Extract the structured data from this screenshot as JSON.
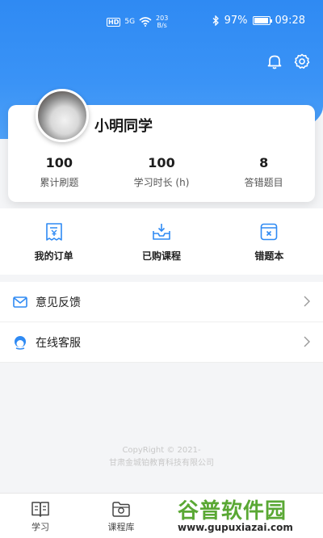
{
  "status_bar": {
    "network_badge": "HD",
    "signal": "5G",
    "speed_value": "203",
    "speed_unit": "B/s",
    "battery": "97%",
    "battery_level": 0.97,
    "time": "09:28"
  },
  "header": {
    "icons": [
      "bell-icon",
      "settings-icon"
    ]
  },
  "profile": {
    "username": "小明同学",
    "stats": [
      {
        "value": "100",
        "label": "累计刷题"
      },
      {
        "value": "100",
        "label": "学习时长 (h)"
      },
      {
        "value": "8",
        "label": "答错题目"
      }
    ]
  },
  "actions": [
    {
      "label": "我的订单",
      "icon": "receipt-icon"
    },
    {
      "label": "已购课程",
      "icon": "inbox-icon"
    },
    {
      "label": "错题本",
      "icon": "wrong-book-icon"
    }
  ],
  "menu": [
    {
      "label": "意见反馈",
      "icon": "mail-icon"
    },
    {
      "label": "在线客服",
      "icon": "support-agent-icon"
    }
  ],
  "footer": {
    "line1": "CopyRight © 2021-",
    "line2": "甘肃金城铂教育科技有限公司"
  },
  "tabbar": {
    "tabs": [
      {
        "label": "学习",
        "icon": "book-icon"
      },
      {
        "label": "课程库",
        "icon": "folder-icon"
      }
    ]
  },
  "watermark": {
    "title": "谷普软件园",
    "url": "www.gupuxiazai.com"
  },
  "colors": {
    "accent": "#2f8af3",
    "watermark_green": "#5aa834"
  }
}
